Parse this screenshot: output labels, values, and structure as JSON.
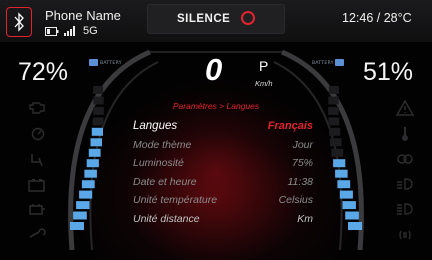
{
  "status_bar": {
    "phone_name": "Phone Name",
    "network": "5G",
    "brand": "SILENCE",
    "clock": "12:46 / 28°C"
  },
  "battery_left": {
    "percent": "72%",
    "label": "BATTERY",
    "level": 0.72
  },
  "battery_right": {
    "percent": "51%",
    "label": "BATTERY",
    "level": 0.51
  },
  "speedometer": {
    "speed": "0",
    "gear": "P",
    "unit": "Km/h"
  },
  "settings": {
    "breadcrumb": "Paramètres > Langues",
    "rows": [
      {
        "label": "Langues",
        "value": "Français"
      },
      {
        "label": "Mode thème",
        "value": "Jour"
      },
      {
        "label": "Luminosité",
        "value": "75%"
      },
      {
        "label": "Date et heure",
        "value": "11:38"
      },
      {
        "label": "Unité température",
        "value": "Celsius"
      },
      {
        "label": "Unité distance",
        "value": "Km"
      }
    ]
  },
  "colors": {
    "accent": "#e2232e",
    "gauge_blue": "#5aa8e8",
    "background": "#020202"
  },
  "icons": {
    "left": [
      "engine-icon",
      "cruise-icon",
      "kickstand-icon",
      "battery-warning-icon",
      "motor-icon",
      "wrench-icon"
    ],
    "right": [
      "warning-triangle-icon",
      "thermometer-icon",
      "position-light-icon",
      "low-beam-icon",
      "high-beam-icon",
      "parking-light-icon"
    ]
  }
}
